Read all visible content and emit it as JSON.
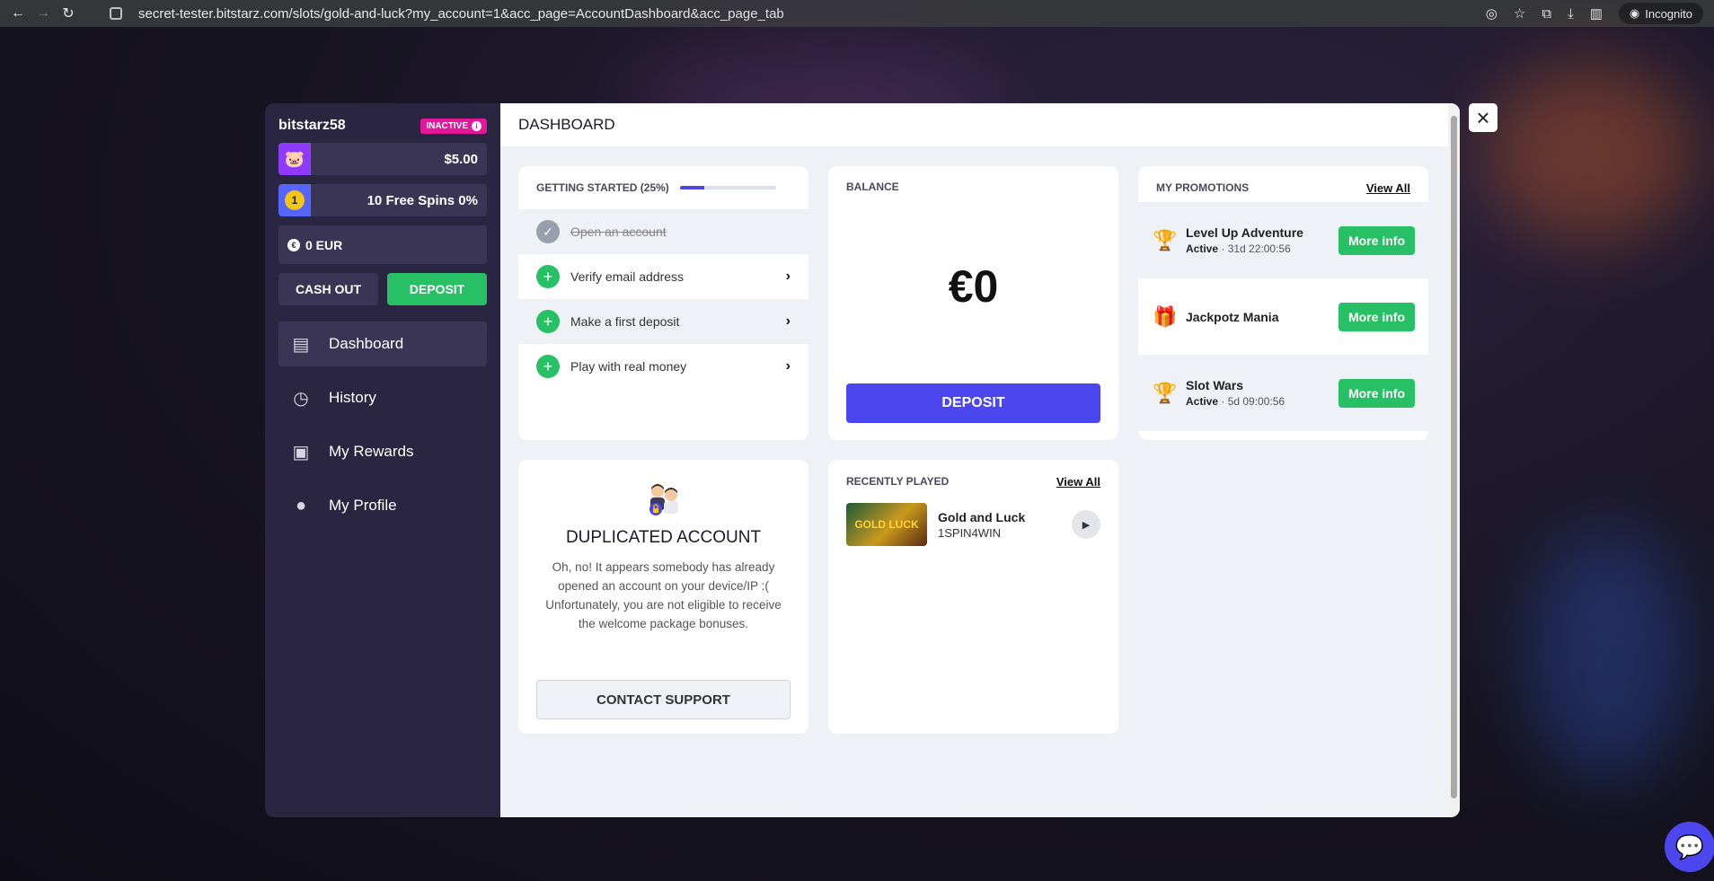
{
  "browser": {
    "url": "secret-tester.bitstarz.com/slots/gold-and-luck?my_account=1&acc_page=AccountDashboard&acc_page_tab",
    "incognito_label": "Incognito"
  },
  "sidebar": {
    "username": "bitstarz58",
    "status_badge": "INACTIVE",
    "balance_value": "$5.00",
    "free_spins": "10 Free Spins 0%",
    "level_number": "1",
    "currency_balance": "0 EUR",
    "cashout_label": "CASH OUT",
    "deposit_label": "DEPOSIT",
    "menu": [
      {
        "label": "Dashboard",
        "icon": "dashboard-icon",
        "active": true
      },
      {
        "label": "History",
        "icon": "history-icon"
      },
      {
        "label": "My Rewards",
        "icon": "rewards-icon"
      },
      {
        "label": "My Profile",
        "icon": "profile-icon"
      }
    ]
  },
  "main": {
    "title": "DASHBOARD",
    "getting_started": {
      "title": "GETTING STARTED (25%)",
      "progress": 0.25,
      "steps": [
        {
          "label": "Open an account",
          "done": true
        },
        {
          "label": "Verify email address",
          "done": false
        },
        {
          "label": "Make a first deposit",
          "done": false
        },
        {
          "label": "Play with real money",
          "done": false
        }
      ]
    },
    "balance": {
      "title": "BALANCE",
      "amount": "€0",
      "deposit_label": "DEPOSIT"
    },
    "promotions": {
      "title": "MY PROMOTIONS",
      "view_all": "View All",
      "items": [
        {
          "name": "Level Up Adventure",
          "status": "Active",
          "time": " · 31d 22:00:56",
          "icon": "trophy-icon",
          "button": "More info"
        },
        {
          "name": "Jackpotz Mania",
          "status": "",
          "time": "",
          "icon": "gift-icon",
          "button": "More info"
        },
        {
          "name": "Slot Wars",
          "status": "Active",
          "time": " · 5d 09:00:56",
          "icon": "trophy-icon",
          "button": "More info"
        }
      ]
    },
    "duplicated": {
      "title": "DUPLICATED ACCOUNT",
      "text": "Oh, no! It appears somebody has already opened an account on your device/IP :( Unfortunately, you are not eligible to receive the welcome package bonuses.",
      "button": "CONTACT SUPPORT"
    },
    "recently_played": {
      "title": "RECENTLY PLAYED",
      "view_all": "View All",
      "game": {
        "name": "Gold and Luck",
        "provider": "1SPIN4WIN",
        "thumb_text": "GOLD LUCK"
      }
    }
  },
  "colors": {
    "sidebar_bg": "#2a2540",
    "accent": "#4c46ef",
    "green": "#27c064",
    "badge": "#e4169a"
  }
}
